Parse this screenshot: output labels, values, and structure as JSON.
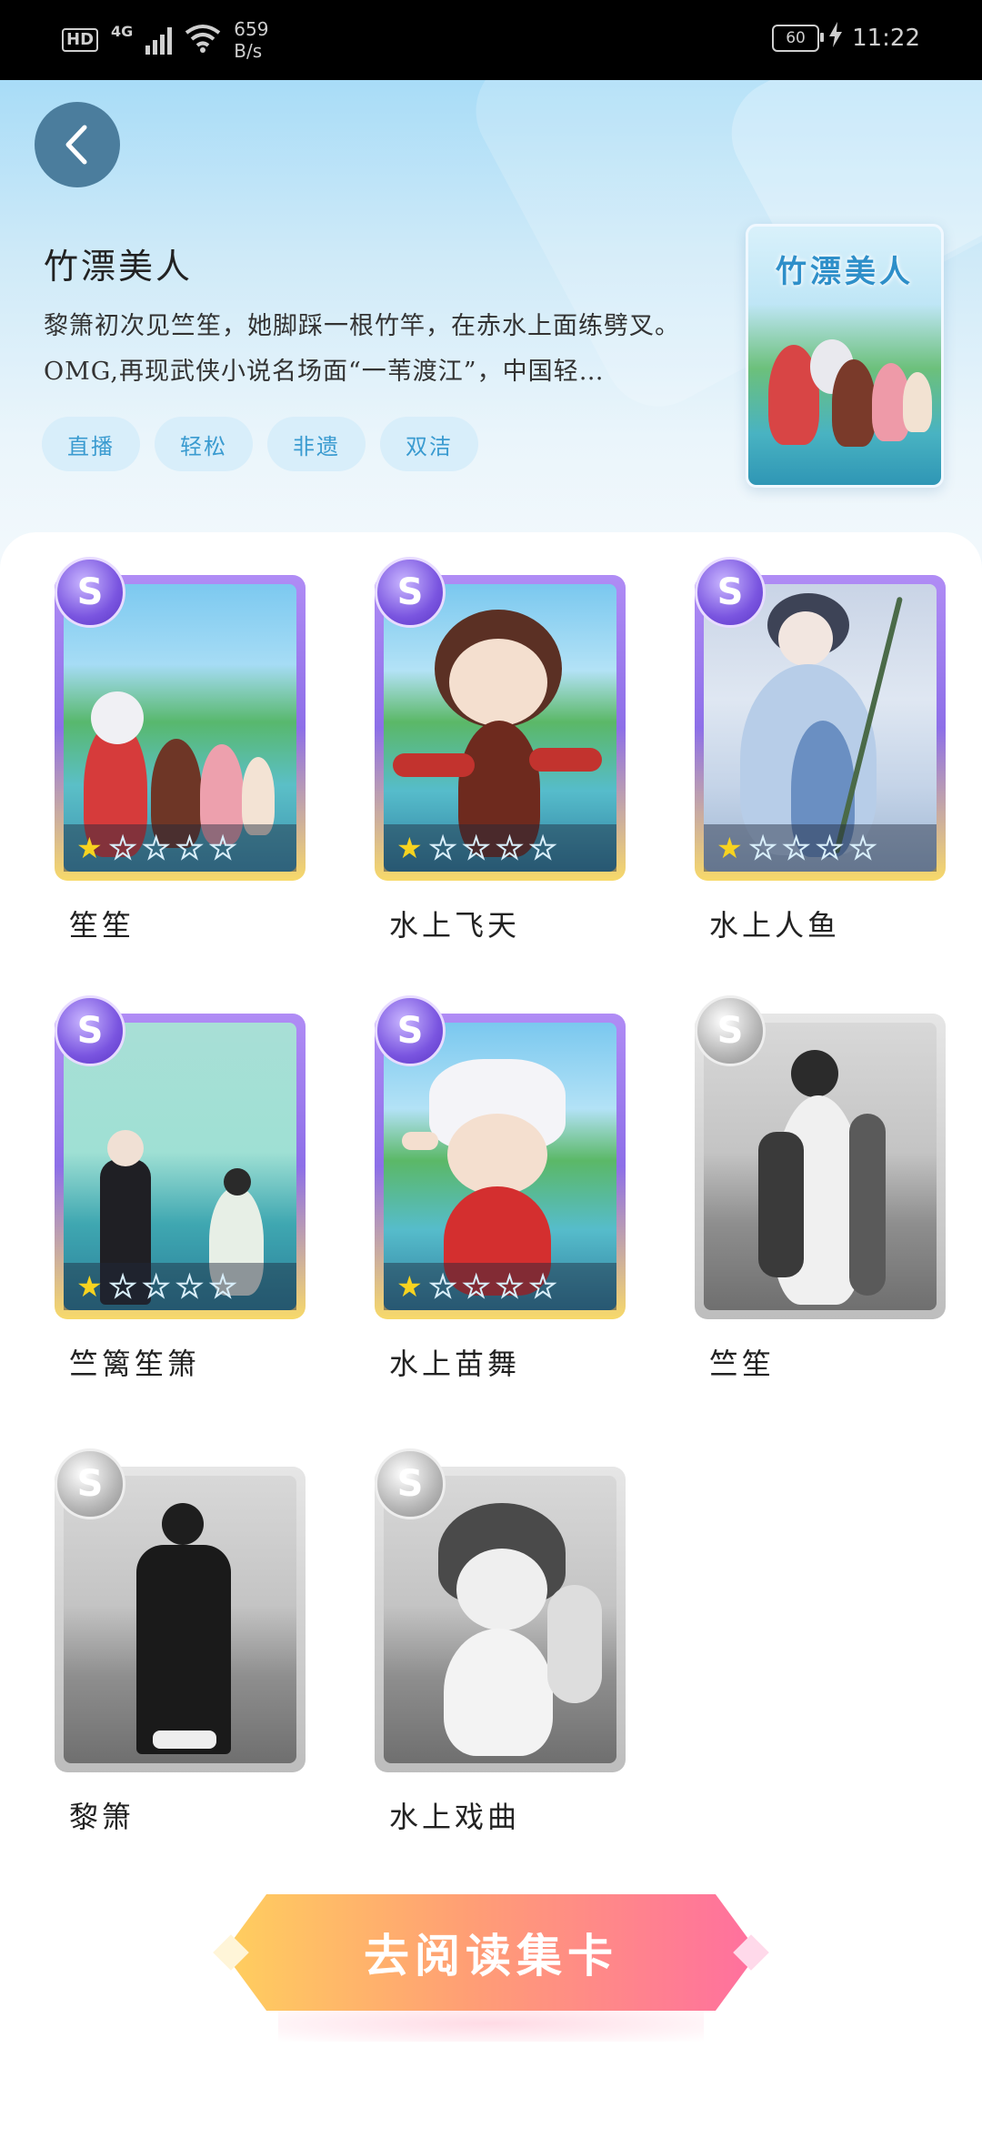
{
  "status_bar": {
    "hd": "HD",
    "network": "4G",
    "speed_value": "659",
    "speed_unit": "B/s",
    "battery": "60",
    "time": "11:22"
  },
  "topic": {
    "title": "竹漂美人",
    "description": "黎箫初次见竺笙，她脚踩一根竹竿，在赤水上面练劈叉。OMG,再现武侠小说名场面“一苇渡江”，中国轻…",
    "tags": [
      "直播",
      "轻松",
      "非遗",
      "双洁"
    ],
    "cover_title": "竹漂美人"
  },
  "cards": [
    {
      "name": "笙笙",
      "rank": "S",
      "stars_lit": 1,
      "stars_total": 5,
      "collected": true
    },
    {
      "name": "水上飞天",
      "rank": "S",
      "stars_lit": 1,
      "stars_total": 5,
      "collected": true
    },
    {
      "name": "水上人鱼",
      "rank": "S",
      "stars_lit": 1,
      "stars_total": 5,
      "collected": true
    },
    {
      "name": "竺篱笙箫",
      "rank": "S",
      "stars_lit": 1,
      "stars_total": 5,
      "collected": true
    },
    {
      "name": "水上苗舞",
      "rank": "S",
      "stars_lit": 1,
      "stars_total": 5,
      "collected": true
    },
    {
      "name": "竺笙",
      "rank": "S",
      "collected": false
    },
    {
      "name": "黎箫",
      "rank": "S",
      "collected": false
    },
    {
      "name": "水上戏曲",
      "rank": "S",
      "collected": false
    }
  ],
  "cta": {
    "label": "去阅读集卡"
  }
}
